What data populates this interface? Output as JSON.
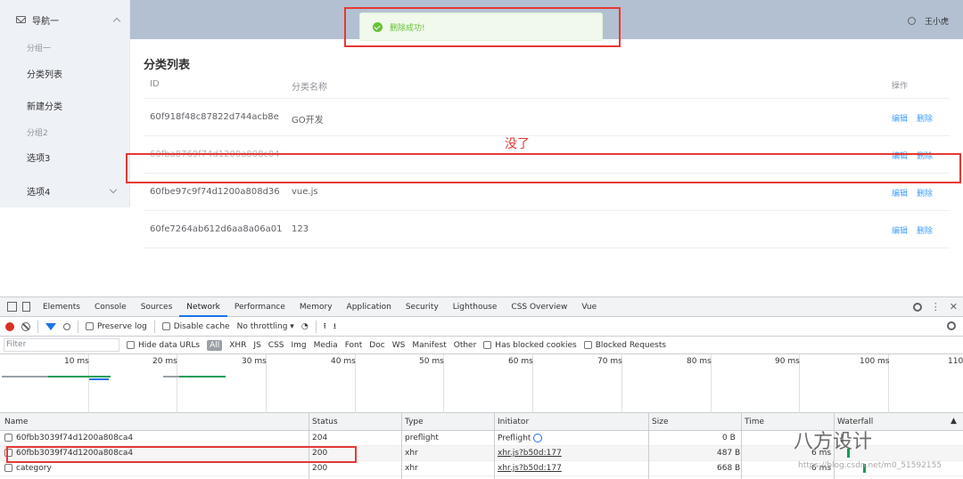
{
  "sidebar": {
    "nav_title": "导航一",
    "group1": "分组一",
    "item_list": "分类列表",
    "item_new": "新建分类",
    "group2": "分组2",
    "item3": "选项3",
    "item4": "选项4"
  },
  "header": {
    "username": "王小虎"
  },
  "toast": {
    "message": "删除成功!"
  },
  "page": {
    "title": "分类列表",
    "columns": [
      "ID",
      "分类名称",
      "操作"
    ],
    "rows": [
      {
        "id": "60f918f48c87822d744acb8e",
        "name": "GO开发",
        "edit": "编辑",
        "delete": "删除"
      },
      {
        "id": "60fba8769f74d1200a808c04",
        "name": "",
        "edit": "编辑",
        "delete": "删除"
      },
      {
        "id": "60fbe97c9f74d1200a808d36",
        "name": "vue.js",
        "edit": "编辑",
        "delete": "删除"
      },
      {
        "id": "60fe7264ab612d6aa8a06a01",
        "name": "123",
        "edit": "编辑",
        "delete": "删除"
      }
    ]
  },
  "annotation": {
    "text": "没了",
    "color": "#e53935"
  },
  "devtools": {
    "tabs": [
      "Elements",
      "Console",
      "Sources",
      "Network",
      "Performance",
      "Memory",
      "Application",
      "Security",
      "Lighthouse",
      "CSS Overview",
      "Vue"
    ],
    "active_tab": "Network",
    "toolbar": {
      "preserve_log": "Preserve log",
      "disable_cache": "Disable cache",
      "throttling": "No throttling"
    },
    "filter": {
      "placeholder": "Filter",
      "hide_data_urls": "Hide data URLs",
      "types": [
        "All",
        "XHR",
        "JS",
        "CSS",
        "Img",
        "Media",
        "Font",
        "Doc",
        "WS",
        "Manifest",
        "Other"
      ],
      "has_blocked_cookies": "Has blocked cookies",
      "blocked_requests": "Blocked Requests"
    },
    "timeline_ticks": [
      "10 ms",
      "20 ms",
      "30 ms",
      "40 ms",
      "50 ms",
      "60 ms",
      "70 ms",
      "80 ms",
      "90 ms",
      "100 ms",
      "110"
    ],
    "network_columns": [
      "Name",
      "Status",
      "Type",
      "Initiator",
      "Size",
      "Time",
      "Waterfall"
    ],
    "requests": [
      {
        "name": "60fbb3039f74d1200a808ca4",
        "status": "204",
        "type": "preflight",
        "initiator": "Preflight",
        "size": "0 B",
        "time": ""
      },
      {
        "name": "60fbb3039f74d1200a808ca4",
        "status": "200",
        "type": "xhr",
        "initiator": "xhr.js?b50d:177",
        "size": "487 B",
        "time": "6 ms"
      },
      {
        "name": "category",
        "status": "200",
        "type": "xhr",
        "initiator": "xhr.js?b50d:177",
        "size": "668 B",
        "time": "6 ms"
      }
    ]
  },
  "watermark": {
    "brand": "八方设计",
    "url": "https://blog.csdn.net/m0_51592155"
  },
  "colors": {
    "accent": "#409eff",
    "success": "#67c23a",
    "annotation": "#e53935",
    "header_bg": "#b3c0d1"
  }
}
